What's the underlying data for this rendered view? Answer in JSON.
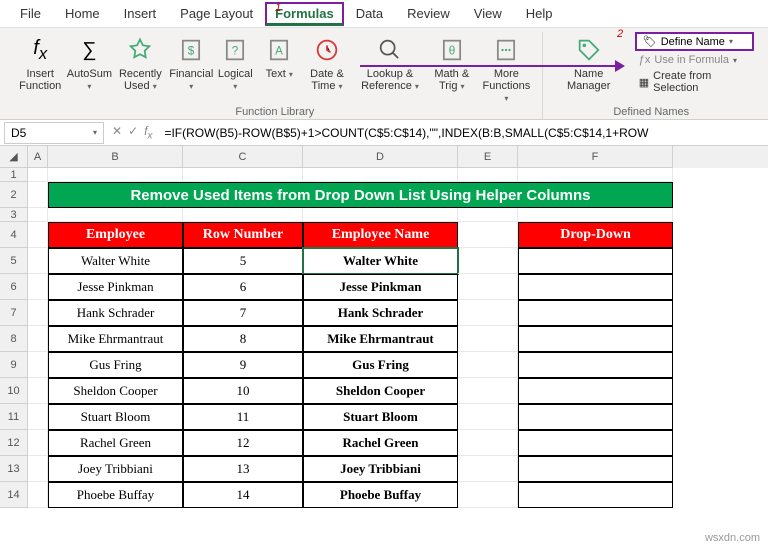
{
  "menu": {
    "items": [
      "File",
      "Home",
      "Insert",
      "Page Layout",
      "Formulas",
      "Data",
      "Review",
      "View",
      "Help"
    ],
    "active": "Formulas"
  },
  "annotations": {
    "one": "1",
    "two": "2"
  },
  "ribbon": {
    "insert_function": "Insert\nFunction",
    "autosum": "AutoSum",
    "recently_used": "Recently\nUsed",
    "financial": "Financial",
    "logical": "Logical",
    "text": "Text",
    "date_time": "Date &\nTime",
    "lookup_reference": "Lookup &\nReference",
    "math_trig": "Math &\nTrig",
    "more_functions": "More\nFunctions",
    "function_library": "Function Library",
    "name_manager": "Name\nManager",
    "define_name": "Define Name",
    "use_in_formula": "Use in Formula",
    "create_from_selection": "Create from Selection",
    "defined_names": "Defined Names"
  },
  "formula_bar": {
    "cell_ref": "D5",
    "formula": "=IF(ROW(B5)-ROW(B$5)+1>COUNT(C$5:C$14),\"\",INDEX(B:B,SMALL(C$5:C$14,1+ROW"
  },
  "columns": [
    "A",
    "B",
    "C",
    "D",
    "E",
    "F"
  ],
  "rows": [
    "1",
    "2",
    "3",
    "4",
    "5",
    "6",
    "7",
    "8",
    "9",
    "10",
    "11",
    "12",
    "13",
    "14"
  ],
  "sheet": {
    "title": "Remove Used Items from Drop Down List Using Helper Columns",
    "headers": {
      "employee": "Employee",
      "row_number": "Row Number",
      "employee_name": "Employee Name",
      "dropdown": "Drop-Down"
    },
    "data": [
      {
        "employee": "Walter White",
        "row": "5",
        "name": "Walter White"
      },
      {
        "employee": "Jesse Pinkman",
        "row": "6",
        "name": "Jesse Pinkman"
      },
      {
        "employee": "Hank Schrader",
        "row": "7",
        "name": "Hank Schrader"
      },
      {
        "employee": "Mike Ehrmantraut",
        "row": "8",
        "name": "Mike Ehrmantraut"
      },
      {
        "employee": "Gus Fring",
        "row": "9",
        "name": "Gus Fring"
      },
      {
        "employee": "Sheldon Cooper",
        "row": "10",
        "name": "Sheldon Cooper"
      },
      {
        "employee": "Stuart Bloom",
        "row": "11",
        "name": "Stuart Bloom"
      },
      {
        "employee": "Rachel Green",
        "row": "12",
        "name": "Rachel Green"
      },
      {
        "employee": "Joey Tribbiani",
        "row": "13",
        "name": "Joey Tribbiani"
      },
      {
        "employee": "Phoebe Buffay",
        "row": "14",
        "name": "Phoebe Buffay"
      }
    ]
  },
  "watermark": "wsxdn.com"
}
